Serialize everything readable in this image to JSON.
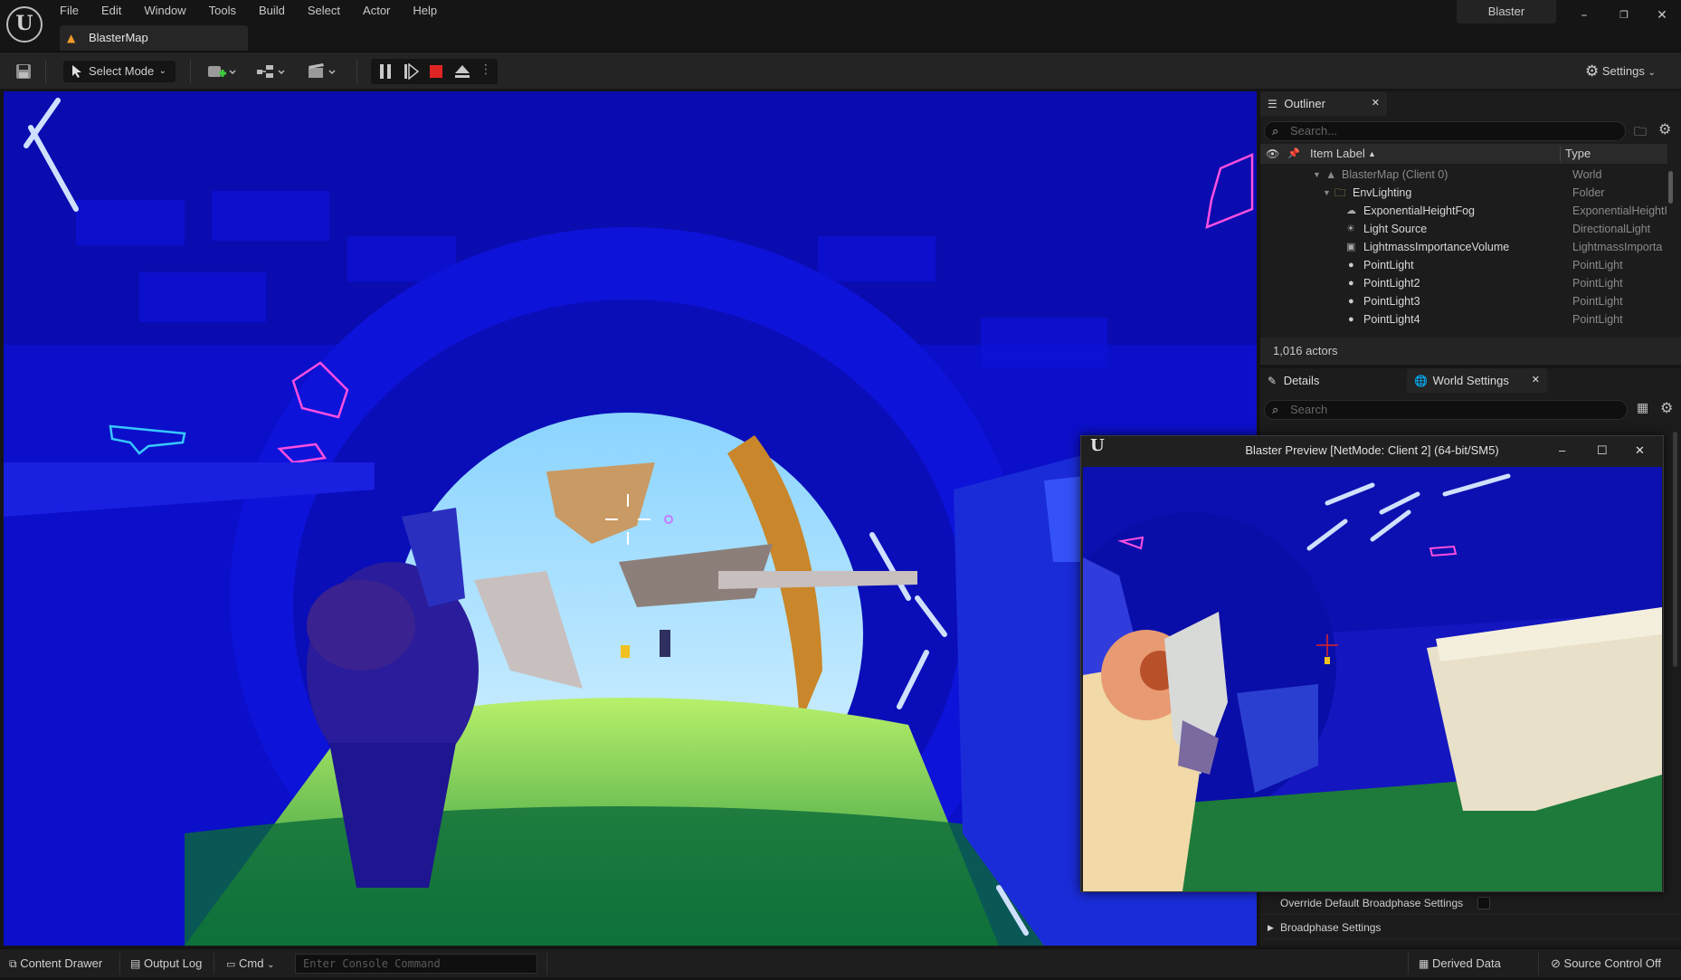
{
  "menu": [
    "File",
    "Edit",
    "Window",
    "Tools",
    "Build",
    "Select",
    "Actor",
    "Help"
  ],
  "tab": {
    "label": "BlasterMap",
    "icon": "level-warning-icon"
  },
  "project_name": "Blaster",
  "toolbar": {
    "select_mode": "Select Mode",
    "settings": "Settings"
  },
  "outliner": {
    "tab_label": "Outliner",
    "search_placeholder": "Search...",
    "col_label": "Item Label",
    "col_type": "Type",
    "rows": [
      {
        "name": "BlasterMap (Client 0)",
        "type": "World",
        "icon": "world-icon"
      },
      {
        "name": "EnvLighting",
        "type": "Folder",
        "icon": "folder-icon"
      },
      {
        "name": "ExponentialHeightFog",
        "type": "ExponentialHeightI",
        "icon": "fog-icon"
      },
      {
        "name": "Light Source",
        "type": "DirectionalLight",
        "icon": "sun-icon"
      },
      {
        "name": "LightmassImportanceVolume",
        "type": "LightmassImporta",
        "icon": "volume-icon"
      },
      {
        "name": "PointLight",
        "type": "PointLight",
        "icon": "bulb-icon"
      },
      {
        "name": "PointLight2",
        "type": "PointLight",
        "icon": "bulb-icon"
      },
      {
        "name": "PointLight3",
        "type": "PointLight",
        "icon": "bulb-icon"
      },
      {
        "name": "PointLight4",
        "type": "PointLight",
        "icon": "bulb-icon"
      }
    ],
    "actor_count": "1,016 actors"
  },
  "details": {
    "tab_details": "Details",
    "tab_world": "World Settings",
    "search_placeholder": "Search",
    "rows": [
      {
        "label": "Override Default Broadphase Settings",
        "kind": "checkbox"
      },
      {
        "label": "Broadphase Settings",
        "kind": "section"
      }
    ]
  },
  "preview": {
    "title": "Blaster Preview [NetMode: Client 2]  (64-bit/SM5)"
  },
  "bottom": {
    "content_drawer": "Content Drawer",
    "output_log": "Output Log",
    "cmd": "Cmd",
    "console_placeholder": "Enter Console Command",
    "derived_data": "Derived Data",
    "source_control": "Source Control Off"
  },
  "colors": {
    "accent_orange": "#f09a2a",
    "stop_red": "#e02424",
    "scene_blue": "#0a0dc8",
    "neon_pink": "#ff4fe0"
  }
}
